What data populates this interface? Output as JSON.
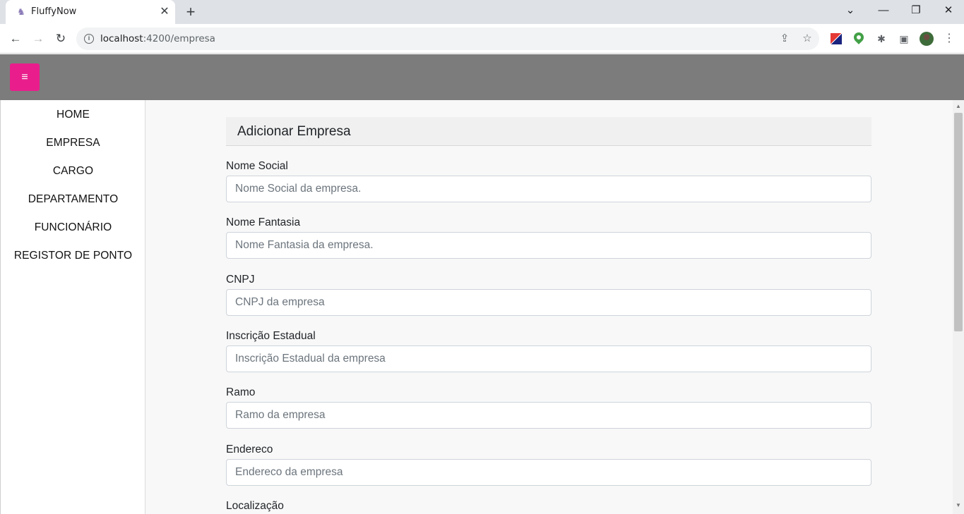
{
  "browser": {
    "tab_title": "FluffyNow",
    "tab_close": "✕",
    "new_tab": "+",
    "url_host": "localhost",
    "url_path": ":4200/empresa",
    "window_controls": {
      "minimize": "—",
      "restore": "❐",
      "close": "✕",
      "dropdown": "⌄"
    }
  },
  "toolbar_icons": {
    "back": "←",
    "forward": "→",
    "reload": "↻",
    "info": "i",
    "share": "⇪",
    "star": "☆",
    "extensions": "✱",
    "sidepanel": "▣",
    "more": "⋮"
  },
  "header": {
    "menu_icon": "≡",
    "accent_color": "#e91e8c",
    "bar_color": "#7c7c7c"
  },
  "sidebar": {
    "items": [
      {
        "label": "HOME"
      },
      {
        "label": "EMPRESA"
      },
      {
        "label": "CARGO"
      },
      {
        "label": "DEPARTAMENTO"
      },
      {
        "label": "FUNCIONÁRIO"
      },
      {
        "label": "REGISTOR DE PONTO"
      }
    ]
  },
  "form": {
    "title": "Adicionar Empresa",
    "fields": [
      {
        "label": "Nome Social",
        "placeholder": "Nome Social da empresa."
      },
      {
        "label": "Nome Fantasia",
        "placeholder": "Nome Fantasia da empresa."
      },
      {
        "label": "CNPJ",
        "placeholder": "CNPJ da empresa"
      },
      {
        "label": "Inscrição Estadual",
        "placeholder": "Inscrição Estadual da empresa"
      },
      {
        "label": "Ramo",
        "placeholder": "Ramo da empresa"
      },
      {
        "label": "Endereco",
        "placeholder": "Endereco da empresa"
      },
      {
        "label": "Localização"
      }
    ]
  }
}
